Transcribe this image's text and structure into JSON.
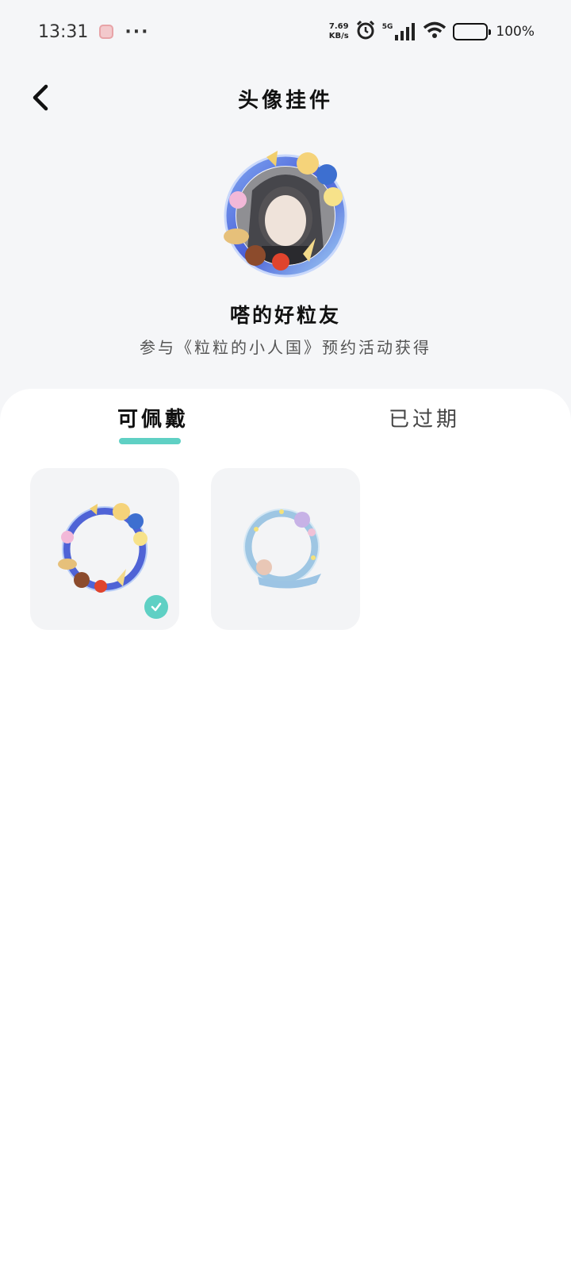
{
  "status_bar": {
    "time": "13:31",
    "more": "···",
    "net_speed_value": "7.69",
    "net_speed_unit": "KB/s",
    "network": "5G",
    "battery_pct": "100%",
    "icons": [
      "alarm-icon",
      "signal-icon",
      "wifi-icon",
      "battery-icon"
    ]
  },
  "header": {
    "title": "头像挂件",
    "back_icon": "chevron-left-icon"
  },
  "preview": {
    "name": "嗒的好粒友",
    "description": "参与《粒粒的小人国》预约活动获得"
  },
  "tabs": [
    {
      "label": "可佩戴",
      "active": true
    },
    {
      "label": "已过期",
      "active": false
    }
  ],
  "pendants": [
    {
      "theme": "food-and-characters-ring",
      "selected": true
    },
    {
      "theme": "blue-ribbon-ring",
      "selected": false
    }
  ],
  "colors": {
    "accent": "#5fd0c4",
    "background": "#f5f6f8",
    "card": "#f3f4f6"
  }
}
